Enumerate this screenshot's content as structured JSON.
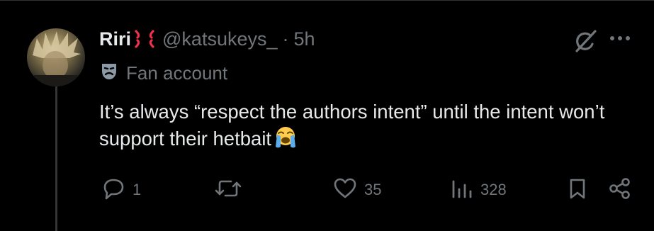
{
  "tweet": {
    "display_name": "Riri",
    "handle": "@katsukeys_",
    "separator": "·",
    "timestamp": "5h",
    "label": "Fan account",
    "text": "It’s always “respect the authors intent” until the intent won’t support their hetbait"
  },
  "actions": {
    "replies": "1",
    "reposts": "",
    "likes": "35",
    "views": "328"
  },
  "icons": {
    "name_emoji": "anger-symbol-icon",
    "label_icon": "theater-mask-icon",
    "text_emoji": "loudly-crying-face-icon"
  },
  "colors": {
    "background": "#000000",
    "primary_text": "#e7e9ea",
    "secondary_text": "#71767b",
    "anger": "#f0304a",
    "divider": "#2f3336"
  }
}
